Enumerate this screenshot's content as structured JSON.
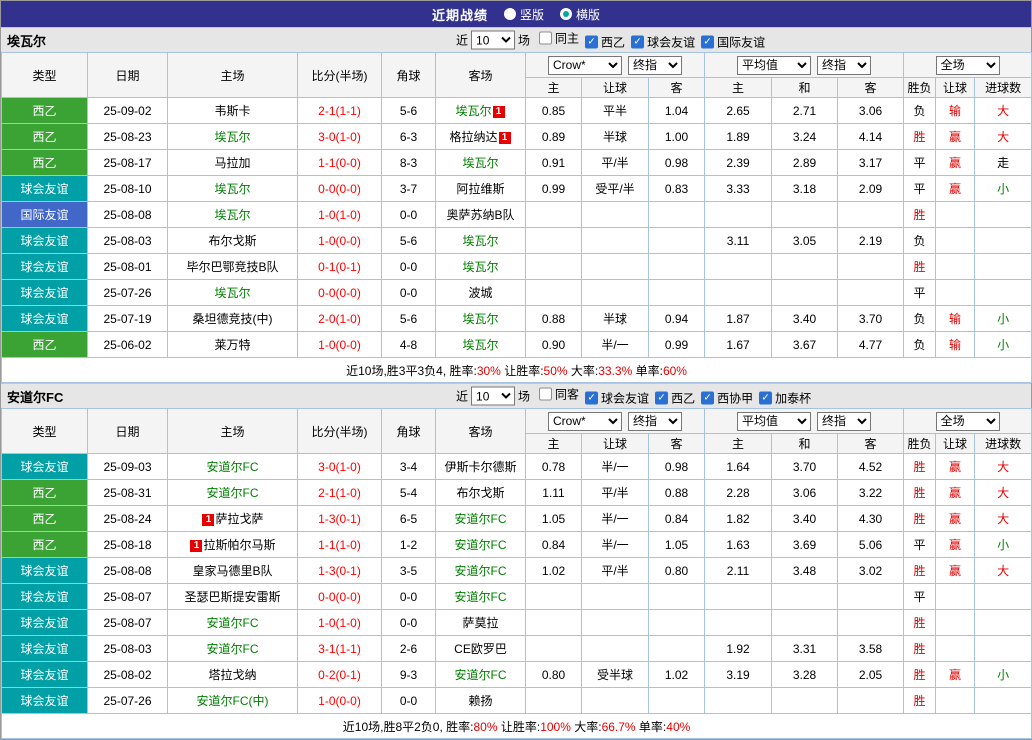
{
  "topbar": {
    "title": "近期战绩",
    "radios": [
      {
        "label": "竖版",
        "selected": false
      },
      {
        "label": "横版",
        "selected": true
      }
    ]
  },
  "icons": {
    "check": "✓"
  },
  "colors": {
    "topbar_bg": "#32328e",
    "border": "#a6c3e3",
    "focal_team": "#008000",
    "score": "#ff0000",
    "red": "#e60000",
    "green": "#008000",
    "black": "#000000",
    "checkbox_on": "#2a6fd3",
    "radio_dot": "#00a99d",
    "type_西乙": "#3ba334",
    "type_球会友谊": "#00a0a6",
    "type_国际友谊": "#4168c8"
  },
  "table_header": {
    "static_cols": [
      "类型",
      "日期",
      "主场",
      "比分(半场)",
      "角球",
      "客场"
    ],
    "group1_selects": [
      "Crow*",
      "终指"
    ],
    "group1_cols": [
      "主",
      "让球",
      "客"
    ],
    "group2_selects": [
      "平均值",
      "终指"
    ],
    "group2_cols": [
      "主",
      "和",
      "客"
    ],
    "group3_selects": [
      "全场"
    ],
    "group3_cols": [
      "胜负",
      "让球",
      "进球数"
    ]
  },
  "sections": [
    {
      "team": "埃瓦尔",
      "filter": {
        "near": "近",
        "count": "10",
        "games": "场",
        "checks": [
          {
            "label": "同主",
            "checked": false
          },
          {
            "label": "西乙",
            "checked": true
          },
          {
            "label": "球会友谊",
            "checked": true
          },
          {
            "label": "国际友谊",
            "checked": true
          }
        ]
      },
      "rows": [
        {
          "type": "西乙",
          "date": "25-09-02",
          "home": {
            "name": "韦斯卡"
          },
          "score": "2-1(1-1)",
          "corners": "5-6",
          "away": {
            "name": "埃瓦尔",
            "green": true,
            "badge": "1",
            "badge_pos": "after"
          },
          "odds": [
            "0.85",
            "平半",
            "1.04"
          ],
          "avg": [
            "2.65",
            "2.71",
            "3.06"
          ],
          "res": [
            [
              "负",
              "k"
            ],
            [
              "输",
              "r"
            ],
            [
              "大",
              "r"
            ]
          ]
        },
        {
          "type": "西乙",
          "date": "25-08-23",
          "home": {
            "name": "埃瓦尔",
            "green": true
          },
          "score": "3-0(1-0)",
          "corners": "6-3",
          "away": {
            "name": "格拉纳达",
            "badge": "1",
            "badge_pos": "after"
          },
          "odds": [
            "0.89",
            "半球",
            "1.00"
          ],
          "avg": [
            "1.89",
            "3.24",
            "4.14"
          ],
          "res": [
            [
              "胜",
              "r"
            ],
            [
              "赢",
              "r"
            ],
            [
              "大",
              "r"
            ]
          ]
        },
        {
          "type": "西乙",
          "date": "25-08-17",
          "home": {
            "name": "马拉加"
          },
          "score": "1-1(0-0)",
          "corners": "8-3",
          "away": {
            "name": "埃瓦尔",
            "green": true
          },
          "odds": [
            "0.91",
            "平/半",
            "0.98"
          ],
          "avg": [
            "2.39",
            "2.89",
            "3.17"
          ],
          "res": [
            [
              "平",
              "k"
            ],
            [
              "赢",
              "r"
            ],
            [
              "走",
              "k"
            ]
          ]
        },
        {
          "type": "球会友谊",
          "date": "25-08-10",
          "home": {
            "name": "埃瓦尔",
            "green": true
          },
          "score": "0-0(0-0)",
          "corners": "3-7",
          "away": {
            "name": "阿拉维斯"
          },
          "odds": [
            "0.99",
            "受平/半",
            "0.83"
          ],
          "avg": [
            "3.33",
            "3.18",
            "2.09"
          ],
          "res": [
            [
              "平",
              "k"
            ],
            [
              "赢",
              "r"
            ],
            [
              "小",
              "g"
            ]
          ]
        },
        {
          "type": "国际友谊",
          "date": "25-08-08",
          "home": {
            "name": "埃瓦尔",
            "green": true
          },
          "score": "1-0(1-0)",
          "corners": "0-0",
          "away": {
            "name": "奥萨苏纳B队"
          },
          "odds": [
            "",
            "",
            ""
          ],
          "avg": [
            "",
            "",
            ""
          ],
          "res": [
            [
              "胜",
              "r"
            ],
            [
              "",
              ""
            ],
            [
              "",
              ""
            ]
          ]
        },
        {
          "type": "球会友谊",
          "date": "25-08-03",
          "home": {
            "name": "布尔戈斯"
          },
          "score": "1-0(0-0)",
          "corners": "5-6",
          "away": {
            "name": "埃瓦尔",
            "green": true
          },
          "odds": [
            "",
            "",
            ""
          ],
          "avg": [
            "3.11",
            "3.05",
            "2.19"
          ],
          "res": [
            [
              "负",
              "k"
            ],
            [
              "",
              ""
            ],
            [
              "",
              ""
            ]
          ]
        },
        {
          "type": "球会友谊",
          "date": "25-08-01",
          "home": {
            "name": "毕尔巴鄂竞技B队"
          },
          "score": "0-1(0-1)",
          "corners": "0-0",
          "away": {
            "name": "埃瓦尔",
            "green": true
          },
          "odds": [
            "",
            "",
            ""
          ],
          "avg": [
            "",
            "",
            ""
          ],
          "res": [
            [
              "胜",
              "r"
            ],
            [
              "",
              ""
            ],
            [
              "",
              ""
            ]
          ]
        },
        {
          "type": "球会友谊",
          "date": "25-07-26",
          "home": {
            "name": "埃瓦尔",
            "green": true
          },
          "score": "0-0(0-0)",
          "corners": "0-0",
          "away": {
            "name": "波城"
          },
          "odds": [
            "",
            "",
            ""
          ],
          "avg": [
            "",
            "",
            ""
          ],
          "res": [
            [
              "平",
              "k"
            ],
            [
              "",
              ""
            ],
            [
              "",
              ""
            ]
          ]
        },
        {
          "type": "球会友谊",
          "date": "25-07-19",
          "home": {
            "name": "桑坦德竞技(中)"
          },
          "score": "2-0(1-0)",
          "corners": "5-6",
          "away": {
            "name": "埃瓦尔",
            "green": true
          },
          "odds": [
            "0.88",
            "半球",
            "0.94"
          ],
          "avg": [
            "1.87",
            "3.40",
            "3.70"
          ],
          "res": [
            [
              "负",
              "k"
            ],
            [
              "输",
              "r"
            ],
            [
              "小",
              "g"
            ]
          ]
        },
        {
          "type": "西乙",
          "date": "25-06-02",
          "home": {
            "name": "莱万特"
          },
          "score": "1-0(0-0)",
          "corners": "4-8",
          "away": {
            "name": "埃瓦尔",
            "green": true
          },
          "odds": [
            "0.90",
            "半/一",
            "0.99"
          ],
          "avg": [
            "1.67",
            "3.67",
            "4.77"
          ],
          "res": [
            [
              "负",
              "k"
            ],
            [
              "输",
              "r"
            ],
            [
              "小",
              "g"
            ]
          ]
        }
      ],
      "summary": {
        "prefix": "近10场,胜3平3负4,",
        "stats": [
          [
            "胜率:",
            "30%"
          ],
          [
            "让胜率:",
            "50%"
          ],
          [
            "大率:",
            "33.3%"
          ],
          [
            "单率:",
            "60%"
          ]
        ]
      }
    },
    {
      "team": "安道尔FC",
      "filter": {
        "near": "近",
        "count": "10",
        "games": "场",
        "checks": [
          {
            "label": "同客",
            "checked": false
          },
          {
            "label": "球会友谊",
            "checked": true
          },
          {
            "label": "西乙",
            "checked": true
          },
          {
            "label": "西协甲",
            "checked": true
          },
          {
            "label": "加泰杯",
            "checked": true
          }
        ]
      },
      "rows": [
        {
          "type": "球会友谊",
          "date": "25-09-03",
          "home": {
            "name": "安道尔FC",
            "green": true
          },
          "score": "3-0(1-0)",
          "corners": "3-4",
          "away": {
            "name": "伊斯卡尔德斯"
          },
          "odds": [
            "0.78",
            "半/一",
            "0.98"
          ],
          "avg": [
            "1.64",
            "3.70",
            "4.52"
          ],
          "res": [
            [
              "胜",
              "r"
            ],
            [
              "赢",
              "r"
            ],
            [
              "大",
              "r"
            ]
          ]
        },
        {
          "type": "西乙",
          "date": "25-08-31",
          "home": {
            "name": "安道尔FC",
            "green": true
          },
          "score": "2-1(1-0)",
          "corners": "5-4",
          "away": {
            "name": "布尔戈斯"
          },
          "odds": [
            "1.11",
            "平/半",
            "0.88"
          ],
          "avg": [
            "2.28",
            "3.06",
            "3.22"
          ],
          "res": [
            [
              "胜",
              "r"
            ],
            [
              "赢",
              "r"
            ],
            [
              "大",
              "r"
            ]
          ]
        },
        {
          "type": "西乙",
          "date": "25-08-24",
          "home": {
            "name": "萨拉戈萨",
            "badge": "1",
            "badge_pos": "before"
          },
          "score": "1-3(0-1)",
          "corners": "6-5",
          "away": {
            "name": "安道尔FC",
            "green": true
          },
          "odds": [
            "1.05",
            "半/一",
            "0.84"
          ],
          "avg": [
            "1.82",
            "3.40",
            "4.30"
          ],
          "res": [
            [
              "胜",
              "r"
            ],
            [
              "赢",
              "r"
            ],
            [
              "大",
              "r"
            ]
          ]
        },
        {
          "type": "西乙",
          "date": "25-08-18",
          "home": {
            "name": "拉斯帕尔马斯",
            "badge": "1",
            "badge_pos": "before"
          },
          "score": "1-1(1-0)",
          "corners": "1-2",
          "away": {
            "name": "安道尔FC",
            "green": true
          },
          "odds": [
            "0.84",
            "半/一",
            "1.05"
          ],
          "avg": [
            "1.63",
            "3.69",
            "5.06"
          ],
          "res": [
            [
              "平",
              "k"
            ],
            [
              "赢",
              "r"
            ],
            [
              "小",
              "g"
            ]
          ]
        },
        {
          "type": "球会友谊",
          "date": "25-08-08",
          "home": {
            "name": "皇家马德里B队"
          },
          "score": "1-3(0-1)",
          "corners": "3-5",
          "away": {
            "name": "安道尔FC",
            "green": true
          },
          "odds": [
            "1.02",
            "平/半",
            "0.80"
          ],
          "avg": [
            "2.11",
            "3.48",
            "3.02"
          ],
          "res": [
            [
              "胜",
              "r"
            ],
            [
              "赢",
              "r"
            ],
            [
              "大",
              "r"
            ]
          ]
        },
        {
          "type": "球会友谊",
          "date": "25-08-07",
          "home": {
            "name": "圣瑟巴斯提安雷斯"
          },
          "score": "0-0(0-0)",
          "corners": "0-0",
          "away": {
            "name": "安道尔FC",
            "green": true
          },
          "odds": [
            "",
            "",
            ""
          ],
          "avg": [
            "",
            "",
            ""
          ],
          "res": [
            [
              "平",
              "k"
            ],
            [
              "",
              ""
            ],
            [
              "",
              ""
            ]
          ]
        },
        {
          "type": "球会友谊",
          "date": "25-08-07",
          "home": {
            "name": "安道尔FC",
            "green": true
          },
          "score": "1-0(1-0)",
          "corners": "0-0",
          "away": {
            "name": "萨莫拉"
          },
          "odds": [
            "",
            "",
            ""
          ],
          "avg": [
            "",
            "",
            ""
          ],
          "res": [
            [
              "胜",
              "r"
            ],
            [
              "",
              ""
            ],
            [
              "",
              ""
            ]
          ]
        },
        {
          "type": "球会友谊",
          "date": "25-08-03",
          "home": {
            "name": "安道尔FC",
            "green": true
          },
          "score": "3-1(1-1)",
          "corners": "2-6",
          "away": {
            "name": "CE欧罗巴"
          },
          "odds": [
            "",
            "",
            ""
          ],
          "avg": [
            "1.92",
            "3.31",
            "3.58"
          ],
          "res": [
            [
              "胜",
              "r"
            ],
            [
              "",
              ""
            ],
            [
              "",
              ""
            ]
          ]
        },
        {
          "type": "球会友谊",
          "date": "25-08-02",
          "home": {
            "name": "塔拉戈纳"
          },
          "score": "0-2(0-1)",
          "corners": "9-3",
          "away": {
            "name": "安道尔FC",
            "green": true
          },
          "odds": [
            "0.80",
            "受半球",
            "1.02"
          ],
          "avg": [
            "3.19",
            "3.28",
            "2.05"
          ],
          "res": [
            [
              "胜",
              "r"
            ],
            [
              "赢",
              "r"
            ],
            [
              "小",
              "g"
            ]
          ]
        },
        {
          "type": "球会友谊",
          "date": "25-07-26",
          "home": {
            "name": "安道尔FC(中)",
            "green": true
          },
          "score": "1-0(0-0)",
          "corners": "0-0",
          "away": {
            "name": "赖扬"
          },
          "odds": [
            "",
            "",
            ""
          ],
          "avg": [
            "",
            "",
            ""
          ],
          "res": [
            [
              "胜",
              "r"
            ],
            [
              "",
              ""
            ],
            [
              "",
              ""
            ]
          ]
        }
      ],
      "summary": {
        "prefix": "近10场,胜8平2负0,",
        "stats": [
          [
            "胜率:",
            "80%"
          ],
          [
            "让胜率:",
            "100%"
          ],
          [
            "大率:",
            "66.7%"
          ],
          [
            "单率:",
            "40%"
          ]
        ]
      }
    }
  ]
}
